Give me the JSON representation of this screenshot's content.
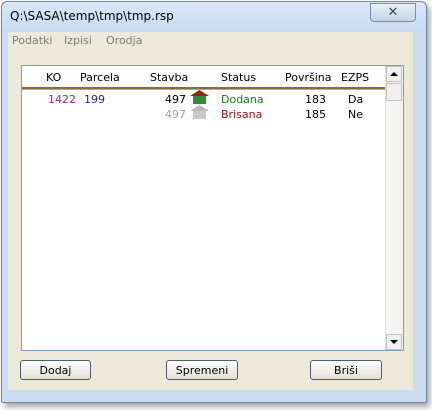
{
  "window": {
    "title": "Q:\\SASA\\temp\\tmp\\tmp.rsp",
    "close_glyph": "✕"
  },
  "menu": [
    "Podatki",
    "Izpisi",
    "Orodja"
  ],
  "table": {
    "columns": [
      "KO",
      "Parcela",
      "Stavba",
      "Status",
      "Površina",
      "EZPS"
    ],
    "rows": [
      {
        "ko": "1422",
        "parcela": "199",
        "stavba": "497",
        "status": "Dodana",
        "povrsina": "183",
        "ezps": "Da",
        "icon": "house-green-roof-icon"
      },
      {
        "ko": "",
        "parcela": "",
        "stavba": "497",
        "status": "Brisana",
        "povrsina": "185",
        "ezps": "Ne",
        "icon": "house-gray-icon"
      }
    ]
  },
  "buttons": {
    "add": "Dodaj",
    "edit": "Spremeni",
    "delete": "Briši"
  },
  "colors": {
    "ko_text": "#9a2a8c",
    "parcela_text": "#1a2a8c",
    "status_added": "#1a7a1a",
    "status_deleted": "#a01010",
    "deleted_text": "#a0a0a0",
    "header_rule": "#8a6a3c"
  }
}
